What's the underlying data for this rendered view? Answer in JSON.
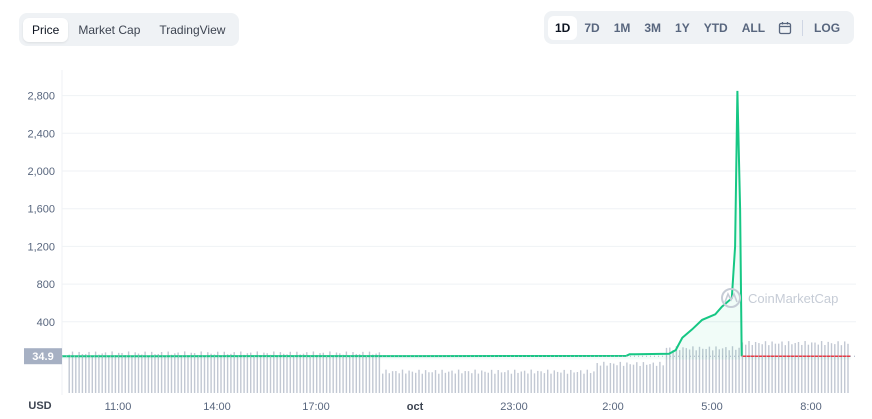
{
  "view_tabs": [
    {
      "label": "Price",
      "active": true
    },
    {
      "label": "Market Cap",
      "active": false
    },
    {
      "label": "TradingView",
      "active": false
    }
  ],
  "range_buttons": [
    {
      "label": "1D",
      "active": true
    },
    {
      "label": "7D",
      "active": false
    },
    {
      "label": "1M",
      "active": false
    },
    {
      "label": "3M",
      "active": false
    },
    {
      "label": "1Y",
      "active": false
    },
    {
      "label": "YTD",
      "active": false
    },
    {
      "label": "ALL",
      "active": false
    }
  ],
  "calendar_icon": "calendar-icon",
  "log_label": "LOG",
  "currency_label": "USD",
  "watermark": "CoinMarketCap",
  "colors": {
    "line": "#16c784",
    "fill": "#16c784",
    "current_line": "#ea3943",
    "current_label_bg": "#a6b0c3",
    "grid": "#eff2f5",
    "volume": "#c2c8d3"
  },
  "chart_data": {
    "type": "line",
    "title": "",
    "xlabel": "",
    "ylabel": "",
    "ylim": [
      0,
      2900
    ],
    "yticks": [
      400,
      800,
      1200,
      1600,
      2000,
      2400,
      2800
    ],
    "ytick_labels": [
      "400",
      "800",
      "1,200",
      "1,600",
      "2,000",
      "2,400",
      "2,800"
    ],
    "x_range_hours": [
      9.2,
      26.6
    ],
    "xticks": [
      {
        "h": 11,
        "label": "11:00",
        "bold": false
      },
      {
        "h": 14,
        "label": "14:00",
        "bold": false
      },
      {
        "h": 17,
        "label": "17:00",
        "bold": false
      },
      {
        "h": 20,
        "label": "oct",
        "bold": true
      },
      {
        "h": 23,
        "label": "23:00",
        "bold": false
      },
      {
        "h": 26,
        "label": "2:00",
        "bold": false
      },
      {
        "h": 29,
        "label": "5:00",
        "bold": false
      },
      {
        "h": 32,
        "label": "8:00",
        "bold": false
      }
    ],
    "current_price_label": "34.9",
    "current_price": 34.9,
    "grid": true,
    "series": [
      {
        "values": [
          [
            9.2,
            34.9
          ],
          [
            12,
            35
          ],
          [
            16,
            36
          ],
          [
            20,
            36
          ],
          [
            24,
            37
          ],
          [
            26.4,
            38
          ],
          [
            26.5,
            55
          ],
          [
            27.7,
            60
          ],
          [
            27.9,
            100
          ],
          [
            28.1,
            230
          ],
          [
            28.4,
            320
          ],
          [
            28.7,
            420
          ],
          [
            29.1,
            480
          ],
          [
            29.3,
            560
          ],
          [
            29.6,
            650
          ],
          [
            29.7,
            1200
          ],
          [
            29.77,
            2850
          ],
          [
            29.85,
            1600
          ],
          [
            29.9,
            34.9
          ],
          [
            33.2,
            34.9
          ]
        ]
      }
    ],
    "volume": [
      {
        "from": 9.5,
        "to": 19.0,
        "level": 0.8
      },
      {
        "from": 19.0,
        "to": 25.5,
        "level": 0.45
      },
      {
        "from": 25.5,
        "to": 27.6,
        "level": 0.6
      },
      {
        "from": 27.6,
        "to": 29.9,
        "level": 0.9
      },
      {
        "from": 29.9,
        "to": 33.2,
        "level": 1.0
      }
    ]
  }
}
